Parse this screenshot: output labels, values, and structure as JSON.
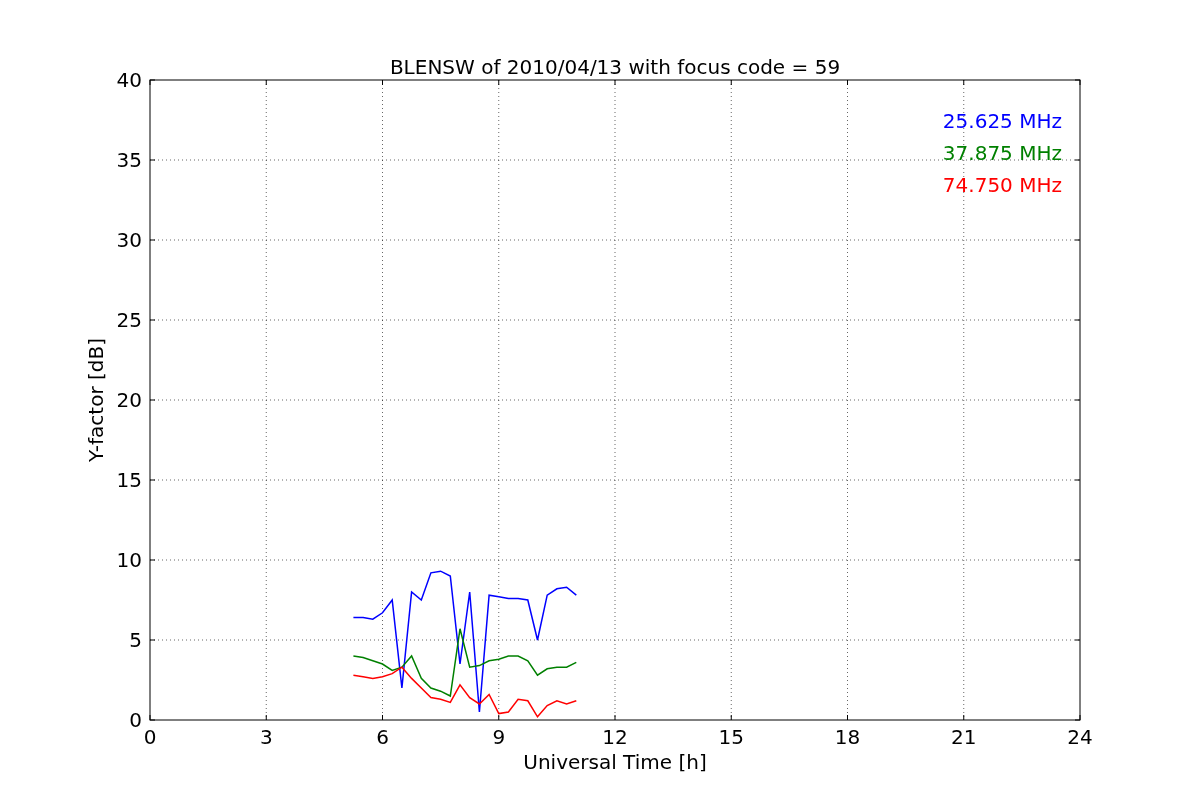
{
  "figure": {
    "chart_data": {
      "type": "line",
      "grid": true,
      "title": "BLENSW of 2010/04/13 with focus code = 59",
      "xlabel": "Universal Time [h]",
      "ylabel": "Y-factor [dB]",
      "xlim": [
        0,
        24
      ],
      "ylim": [
        0,
        40
      ],
      "xticks": [
        0,
        3,
        6,
        9,
        12,
        15,
        18,
        21,
        24
      ],
      "yticks": [
        0,
        5,
        10,
        15,
        20,
        25,
        30,
        35,
        40
      ],
      "x": [
        5.25,
        5.5,
        5.75,
        6.0,
        6.25,
        6.5,
        6.75,
        7.0,
        7.25,
        7.5,
        7.75,
        8.0,
        8.25,
        8.5,
        8.75,
        9.0,
        9.25,
        9.5,
        9.75,
        10.0,
        10.25,
        10.5,
        10.75,
        11.0
      ],
      "series": [
        {
          "name": "25.625 MHz",
          "color": "#0000ff",
          "values": [
            6.4,
            6.4,
            6.3,
            6.7,
            7.5,
            2.0,
            8.0,
            7.5,
            9.2,
            9.3,
            9.0,
            3.5,
            8.0,
            0.5,
            7.8,
            7.7,
            7.6,
            7.6,
            7.5,
            5.0,
            7.8,
            8.2,
            8.3,
            7.8
          ]
        },
        {
          "name": "37.875 MHz",
          "color": "#008000",
          "values": [
            4.0,
            3.9,
            3.7,
            3.5,
            3.1,
            3.3,
            4.0,
            2.6,
            2.0,
            1.8,
            1.5,
            5.7,
            3.3,
            3.4,
            3.7,
            3.8,
            4.0,
            4.0,
            3.7,
            2.8,
            3.2,
            3.3,
            3.3,
            3.6
          ]
        },
        {
          "name": "74.750 MHz",
          "color": "#ff0000",
          "values": [
            2.8,
            2.7,
            2.6,
            2.7,
            2.9,
            3.3,
            2.6,
            2.0,
            1.4,
            1.3,
            1.1,
            2.2,
            1.4,
            1.0,
            1.6,
            0.4,
            0.5,
            1.3,
            1.2,
            0.2,
            0.9,
            1.2,
            1.0,
            1.2
          ]
        }
      ]
    }
  }
}
